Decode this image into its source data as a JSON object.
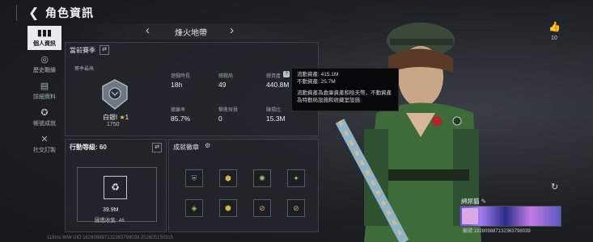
{
  "header": {
    "title": "角色資訊",
    "back_icon": "back-arrow-icon"
  },
  "sidebar": {
    "items": [
      {
        "label": "個人資訊",
        "icon": "stats-icon",
        "active": true
      },
      {
        "label": "歷史戰績",
        "icon": "history-icon",
        "active": false
      },
      {
        "label": "詳細資料",
        "icon": "detail-icon",
        "active": false
      },
      {
        "label": "帳號成就",
        "icon": "achievement-icon",
        "active": false
      },
      {
        "label": "社交訂製",
        "icon": "social-icon",
        "active": false
      }
    ]
  },
  "stage": {
    "name": "烽火地帶"
  },
  "season": {
    "title": "當前賽季",
    "subtitle": "賽季最高",
    "rank_name": "白銀I",
    "rank_stars": "1",
    "rank_score": "1750",
    "stats": [
      {
        "label": "遊戲時長",
        "value": "18h"
      },
      {
        "label": "總戰局",
        "value": "49"
      },
      {
        "label": "總資產",
        "value": "440.8M"
      },
      {
        "label": "撤離率",
        "value": "85.7%"
      },
      {
        "label": "擊敗探員",
        "value": "0"
      },
      {
        "label": "賺損比",
        "value": "15.3M"
      }
    ]
  },
  "tooltip": {
    "line1": "流動資產: 415.1M",
    "line2": "不動資產: 25.7M",
    "desc1": "流動資產為倉庫資產和哈夫幣，不動資產",
    "desc2": "為特勤局設施和收藏室設施"
  },
  "action": {
    "title": "行動等級: 60",
    "value": "39.9M",
    "collect": "圖鑑收集: 46"
  },
  "badges": {
    "title": "成就徽章"
  },
  "profile": {
    "likes": "10",
    "name": "綿屌貓",
    "id": "編號:182809887132363798039"
  },
  "watermark": "118ms    WW UID:182809887132363798039 202605150315",
  "colors": {
    "active_tab_bg": "#e8eaec",
    "panel_bg": "#22262b",
    "accent": "#f0f0f0"
  }
}
